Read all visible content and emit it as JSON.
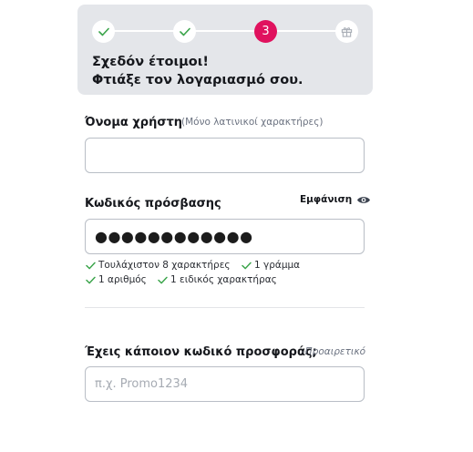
{
  "stepper": {
    "active_step": "3",
    "title": "Σχεδόν έτοιμοι!",
    "subtitle": "Φτιάξε τον λογαριασμό σου."
  },
  "username": {
    "label": "Όνομα χρήστη",
    "hint": "(Μόνο λατινικοί χαρακτήρες)",
    "value": "",
    "placeholder": ""
  },
  "password": {
    "label": "Κωδικός πρόσβασης",
    "show_label": "Εμφάνιση",
    "value": "●●●●●●●●●●●●",
    "rules": [
      {
        "text": "Τουλάχιστον 8 χαρακτήρες",
        "met": true
      },
      {
        "text": "1 γράμμα",
        "met": true
      },
      {
        "text": "1 αριθμός",
        "met": true
      },
      {
        "text": "1 ειδικός χαρακτήρας",
        "met": true
      }
    ]
  },
  "promo": {
    "label": "Έχεις κάποιον κωδικό προσφοράς;",
    "hint": "-Προαιρετικό",
    "placeholder": "π.χ. Promo1234"
  },
  "colors": {
    "accent": "#e0125e",
    "check": "#3aa44a",
    "card_bg": "#e4e6ea"
  }
}
